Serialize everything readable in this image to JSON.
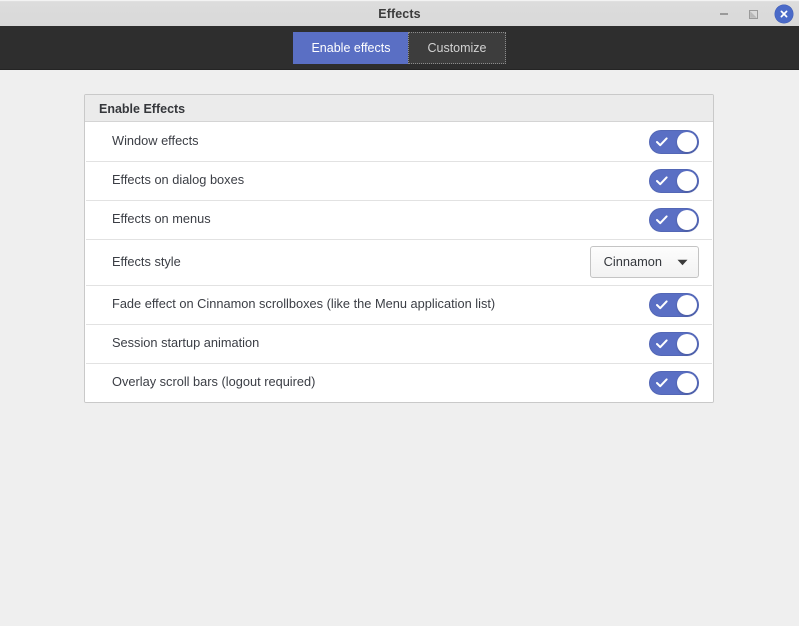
{
  "window": {
    "title": "Effects",
    "controls": {
      "minimize_label": "Minimize",
      "maximize_label": "Restore",
      "close_label": "Close"
    },
    "accent_color": "#5a6fc4",
    "titlebar_color": "#d9d9d9",
    "toolbar_color": "#2e2e2e",
    "body_color": "#efefef"
  },
  "tabs": [
    {
      "label": "Enable effects",
      "active": true,
      "focused": false
    },
    {
      "label": "Customize",
      "active": false,
      "focused": true
    }
  ],
  "panel": {
    "header": "Enable Effects",
    "rows": [
      {
        "label": "Window effects",
        "control": "toggle",
        "value": "on"
      },
      {
        "label": "Effects on dialog boxes",
        "control": "toggle",
        "value": "on"
      },
      {
        "label": "Effects on menus",
        "control": "toggle",
        "value": "on"
      },
      {
        "label": "Effects style",
        "control": "combo",
        "value": "Cinnamon"
      },
      {
        "label": "Fade effect on Cinnamon scrollboxes (like the Menu application list)",
        "control": "toggle",
        "value": "on"
      },
      {
        "label": "Session startup animation",
        "control": "toggle",
        "value": "on"
      },
      {
        "label": "Overlay scroll bars (logout required)",
        "control": "toggle",
        "value": "on"
      }
    ]
  },
  "icons": {
    "minimize": "minimize-icon",
    "maximize": "maximize-icon",
    "close": "close-icon",
    "check": "check-icon",
    "chevron_down": "chevron-down-icon"
  }
}
